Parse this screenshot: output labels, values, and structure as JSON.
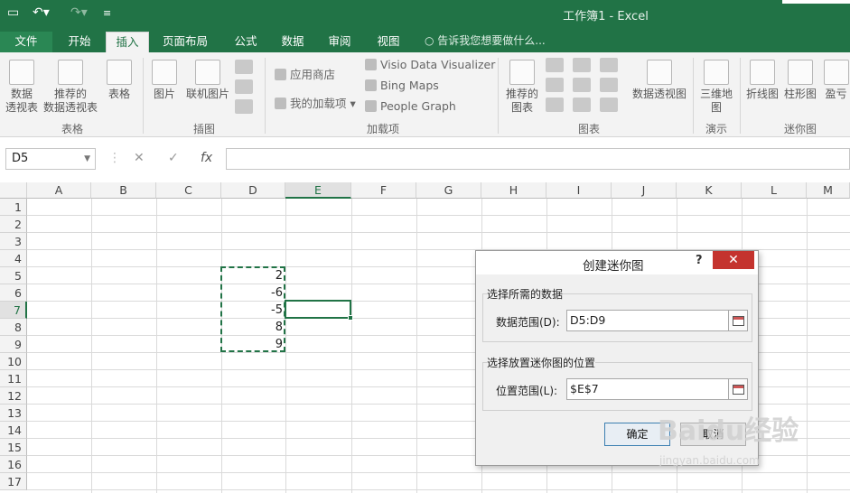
{
  "window": {
    "title": "工作簿1 - Excel"
  },
  "quick_access": {
    "save_icon": "save-icon",
    "undo_icon": "undo-icon",
    "redo_icon": "redo-icon"
  },
  "tabs": [
    {
      "label": "文件"
    },
    {
      "label": "开始"
    },
    {
      "label": "插入"
    },
    {
      "label": "页面布局"
    },
    {
      "label": "公式"
    },
    {
      "label": "数据"
    },
    {
      "label": "审阅"
    },
    {
      "label": "视图"
    }
  ],
  "tell_me": "告诉我您想要做什么...",
  "ribbon": {
    "pivot_table": "数据\n透视表",
    "recommended_pivot": "推荐的\n数据透视表",
    "table": "表格",
    "group_table": "表格",
    "picture": "图片",
    "online_picture": "联机图片",
    "group_illustrations": "插图",
    "store": "应用商店",
    "my_addins": "我的加载项",
    "visio": "Visio Data Visualizer",
    "bing_maps": "Bing Maps",
    "people_graph": "People Graph",
    "group_addins": "加载项",
    "recommended_charts": "推荐的\n图表",
    "pivot_chart": "数据透视图",
    "group_charts": "图表",
    "map3d": "三维地\n图",
    "group_tours": "演示",
    "spark_line": "折线图",
    "spark_column": "柱形图",
    "spark_winloss": "盈亏",
    "group_sparklines": "迷你图"
  },
  "formula_bar": {
    "name_box": "D5",
    "fx": "fx",
    "cancel": "✕",
    "enter": "✓",
    "value": ""
  },
  "columns": [
    "A",
    "B",
    "C",
    "D",
    "E",
    "F",
    "G",
    "H",
    "I",
    "J",
    "K",
    "L",
    "M"
  ],
  "rows": [
    "1",
    "2",
    "3",
    "4",
    "5",
    "6",
    "7",
    "8",
    "9",
    "10",
    "11",
    "12",
    "13",
    "14",
    "15",
    "16",
    "17"
  ],
  "cells": {
    "D5": "2",
    "D6": "-6",
    "D7": "-5",
    "D8": "8",
    "D9": "9"
  },
  "dialog": {
    "title": "创建迷你图",
    "help": "?",
    "close": "✕",
    "section1": "选择所需的数据",
    "data_range_label": "数据范围(D):",
    "data_range_value": "D5:D9",
    "section2": "选择放置迷你图的位置",
    "location_label": "位置范围(L):",
    "location_value": "$E$7",
    "ok": "确定",
    "cancel": "取消"
  },
  "watermark": {
    "logo": "Baidu经验",
    "url": "jingyan.baidu.com"
  }
}
